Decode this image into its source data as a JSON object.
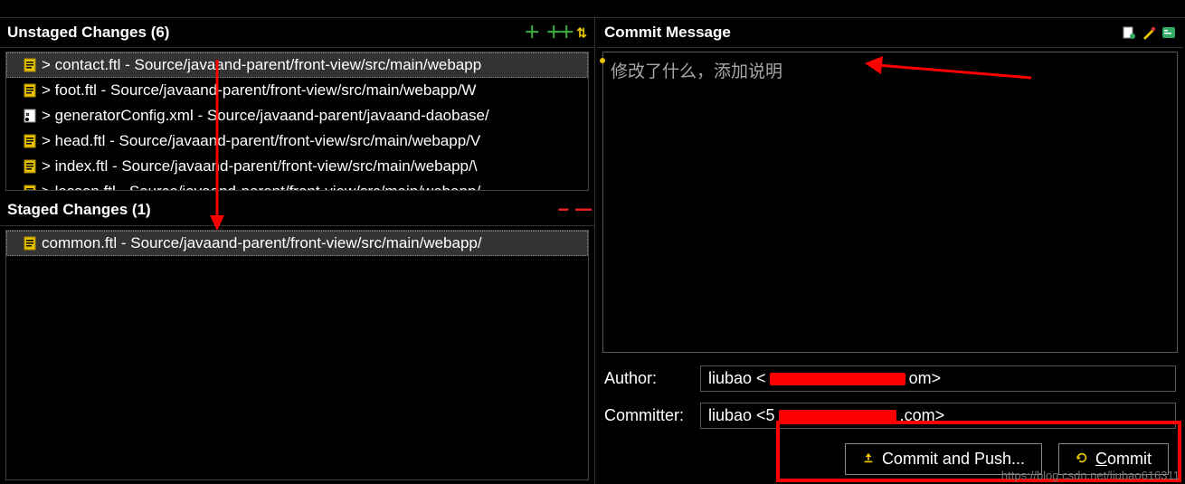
{
  "unstaged": {
    "title": "Unstaged Changes (6)",
    "files": [
      "> contact.ftl - Source/javaand-parent/front-view/src/main/webapp",
      "> foot.ftl - Source/javaand-parent/front-view/src/main/webapp/W",
      "> generatorConfig.xml - Source/javaand-parent/javaand-daobase/",
      "> head.ftl - Source/javaand-parent/front-view/src/main/webapp/V",
      "> index.ftl - Source/javaand-parent/front-view/src/main/webapp/\\",
      "> lesson.ftl - Source/javaand-parent/front-view/src/main/webapp/"
    ]
  },
  "staged": {
    "title": "Staged Changes (1)",
    "files": [
      "common.ftl - Source/javaand-parent/front-view/src/main/webapp/"
    ]
  },
  "commit": {
    "header": "Commit Message",
    "placeholder": "修改了什么，添加说明",
    "author_label": "Author:",
    "committer_label": "Committer:",
    "author_value_prefix": "liubao <",
    "author_value_suffix": "om>",
    "committer_value_prefix": "liubao <5",
    "committer_value_suffix": ".com>",
    "commit_push_btn": "Commit and Push...",
    "commit_btn": "ommit",
    "commit_btn_mnemonic": "C"
  },
  "watermark": "https://blog.csdn.net/liubao616311"
}
